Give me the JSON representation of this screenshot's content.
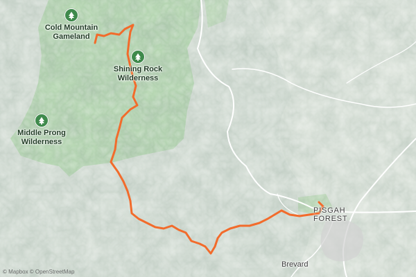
{
  "map": {
    "attribution": "© Mapbox © OpenStreetMap",
    "colors": {
      "terrain": "#dfe6df",
      "protected_area": "#a9d6a3",
      "route": "#f26b2b",
      "roads": "#ffffff",
      "icon": "#3f8a4c"
    }
  },
  "areas": [
    {
      "id": "cold-mountain",
      "label_lines": [
        "Cold Mountain",
        "Gameland"
      ],
      "icon": "tree-icon"
    },
    {
      "id": "shining-rock",
      "label_lines": [
        "Shining Rock",
        "Wilderness"
      ],
      "icon": "tree-icon"
    },
    {
      "id": "middle-prong",
      "label_lines": [
        "Middle Prong",
        "Wilderness"
      ],
      "icon": "tree-icon"
    }
  ],
  "towns": [
    {
      "id": "pisgah-forest",
      "label_lines": [
        "PISGAH",
        "FOREST"
      ]
    },
    {
      "id": "brevard",
      "label_lines": [
        "Brevard"
      ]
    }
  ],
  "route": {
    "name": "",
    "color": "#f26b2b"
  }
}
